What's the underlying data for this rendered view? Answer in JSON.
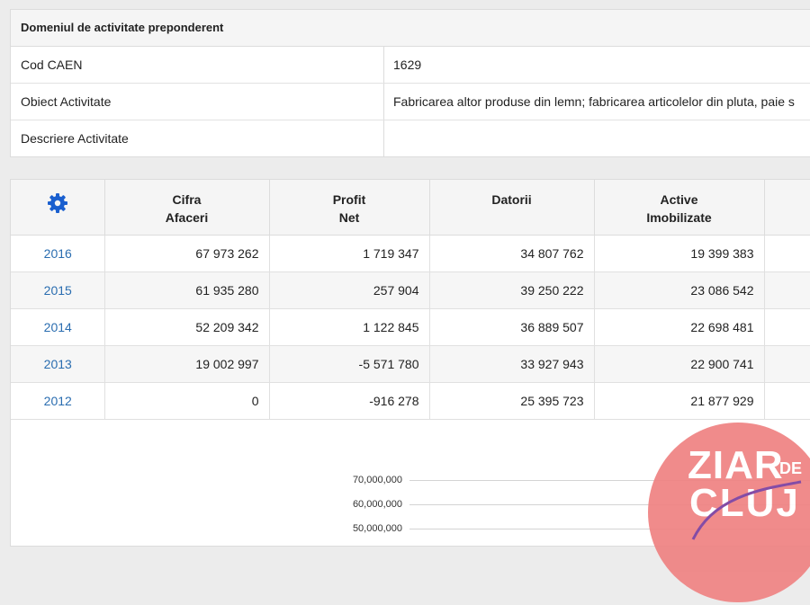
{
  "activity": {
    "header": "Domeniul de activitate preponderent",
    "rows": [
      {
        "label": "Cod CAEN",
        "value": "1629"
      },
      {
        "label": "Obiect Activitate",
        "value": "Fabricarea altor produse din lemn; fabricarea articolelor din pluta, paie s"
      },
      {
        "label": "Descriere Activitate",
        "value": ""
      }
    ]
  },
  "financials": {
    "settings_icon": "gear-icon",
    "columns": [
      {
        "line1": "Cifra",
        "line2": "Afaceri"
      },
      {
        "line1": "Profit",
        "line2": "Net"
      },
      {
        "line1": "Datorii",
        "line2": ""
      },
      {
        "line1": "Active",
        "line2": "Imobilizate"
      }
    ],
    "rows": [
      {
        "year": "2016",
        "values": [
          "67 973 262",
          "1 719 347",
          "34 807 762",
          "19 399 383"
        ]
      },
      {
        "year": "2015",
        "values": [
          "61 935 280",
          "257 904",
          "39 250 222",
          "23 086 542"
        ]
      },
      {
        "year": "2014",
        "values": [
          "52 209 342",
          "1 122 845",
          "36 889 507",
          "22 698 481"
        ]
      },
      {
        "year": "2013",
        "values": [
          "19 002 997",
          "-5 571 780",
          "33 927 943",
          "22 900 741"
        ]
      },
      {
        "year": "2012",
        "values": [
          "0",
          "-916 278",
          "25 395 723",
          "21 877 929"
        ]
      }
    ],
    "year_link_color": "#2a6db0"
  },
  "chart": {
    "y_ticks": [
      "70,000,000",
      "60,000,000",
      "50,000,000"
    ],
    "line_color": "#7b3fa0"
  },
  "watermark": {
    "text_top": "ZIAR",
    "text_de": "DE",
    "text_bottom": "CLUJ",
    "color": "#ef8383"
  }
}
